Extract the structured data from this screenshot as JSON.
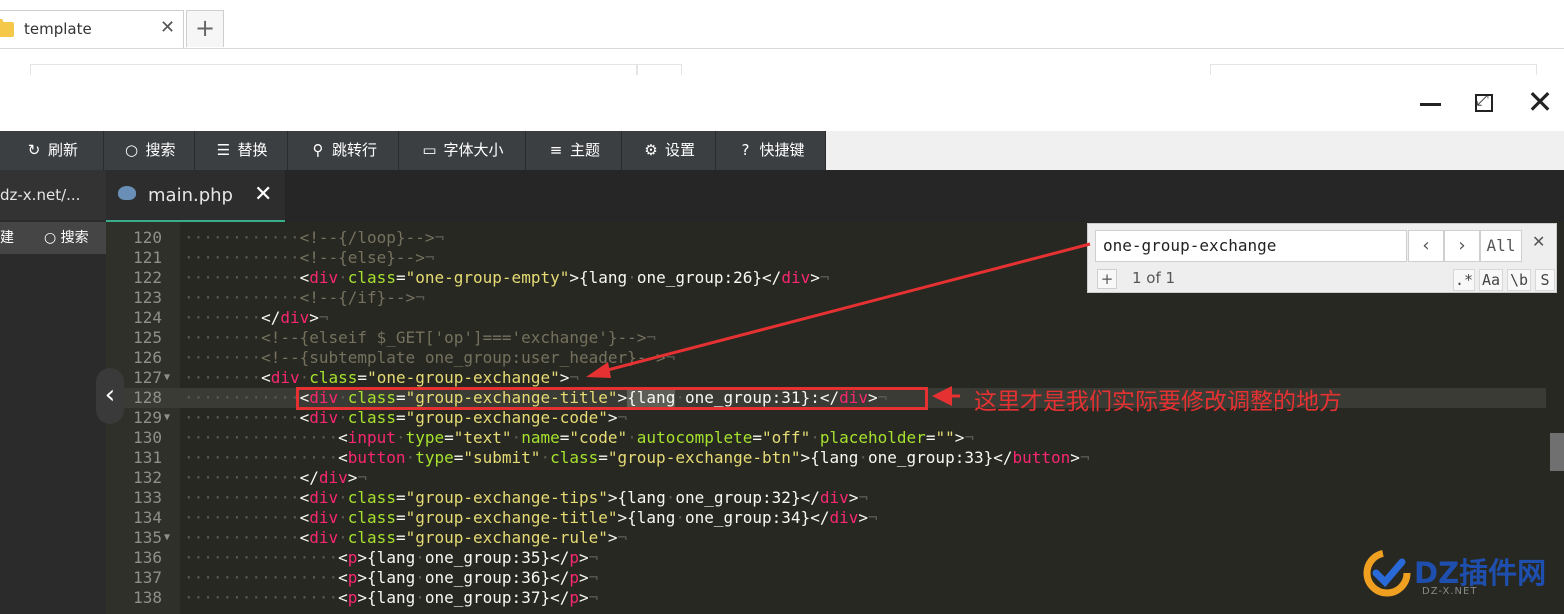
{
  "browser": {
    "tab_title": "template",
    "tab_close": "✕",
    "new_tab": "+"
  },
  "window": {
    "close": "✕"
  },
  "toolbar": {
    "items": [
      {
        "label": "刷新",
        "icon": "↻"
      },
      {
        "label": "搜索",
        "icon": "○"
      },
      {
        "label": "替换",
        "icon": "☰"
      },
      {
        "label": "跳转行",
        "icon": "⚲"
      },
      {
        "label": "字体大小",
        "icon": "▭"
      },
      {
        "label": "主题",
        "icon": "≡"
      },
      {
        "label": "设置",
        "icon": "⚙"
      },
      {
        "label": "快捷键",
        "icon": "?"
      }
    ]
  },
  "left_panel": {
    "tab_label": "dz-x.net/...",
    "action1": "建",
    "action2": "搜索",
    "collapse": "‹"
  },
  "editor": {
    "tab_name": "main.php",
    "tab_close": "✕",
    "lines": [
      {
        "n": "120",
        "indent": 6,
        "code": "<!--{/loop}-->"
      },
      {
        "n": "121",
        "indent": 6,
        "code": "<!--{else}-->"
      },
      {
        "n": "122",
        "indent": 6,
        "code": "<div class=\"one-group-empty\">{lang one_group:26}</div>"
      },
      {
        "n": "123",
        "indent": 6,
        "code": "<!--{/if}-->"
      },
      {
        "n": "124",
        "indent": 4,
        "code": "</div>"
      },
      {
        "n": "125",
        "indent": 4,
        "code": "<!--{elseif $_GET['op']==='exchange'}-->"
      },
      {
        "n": "126",
        "indent": 4,
        "code": "<!--{subtemplate one_group:user_header}-->"
      },
      {
        "n": "127",
        "indent": 4,
        "code": "<div class=\"one-group-exchange\">",
        "fold": true
      },
      {
        "n": "128",
        "indent": 6,
        "code": "<div class=\"group-exchange-title\">{lang one_group:31}:</div>",
        "active": true
      },
      {
        "n": "129",
        "indent": 6,
        "code": "<div class=\"group-exchange-code\">",
        "fold": true
      },
      {
        "n": "130",
        "indent": 8,
        "code": "<input type=\"text\" name=\"code\" autocomplete=\"off\" placeholder=\"\">"
      },
      {
        "n": "131",
        "indent": 8,
        "code": "<button type=\"submit\" class=\"group-exchange-btn\">{lang one_group:33}</button>"
      },
      {
        "n": "132",
        "indent": 6,
        "code": "</div>"
      },
      {
        "n": "133",
        "indent": 6,
        "code": "<div class=\"group-exchange-tips\">{lang one_group:32}</div>"
      },
      {
        "n": "134",
        "indent": 6,
        "code": "<div class=\"group-exchange-title\">{lang one_group:34}</div>"
      },
      {
        "n": "135",
        "indent": 6,
        "code": "<div class=\"group-exchange-rule\">",
        "fold": true
      },
      {
        "n": "136",
        "indent": 8,
        "code": "<p>{lang one_group:35}</p>"
      },
      {
        "n": "137",
        "indent": 8,
        "code": "<p>{lang one_group:36}</p>"
      },
      {
        "n": "138",
        "indent": 8,
        "code": "<p>{lang one_group:37}</p>"
      }
    ]
  },
  "search": {
    "query": "one-group-exchange",
    "prev": "‹",
    "next": "›",
    "all": "All",
    "close": "✕",
    "add": "+",
    "count": "1 of 1",
    "options": [
      ".*",
      "Aa",
      "\\b",
      "S"
    ]
  },
  "annotation": {
    "text": "这里才是我们实际要修改调整的地方",
    "color": "#e53131"
  },
  "watermark": {
    "text": "DZ插件网",
    "sub": "DZ-X.NET"
  },
  "colors": {
    "editor_bg": "#272822",
    "tag": "#f92672",
    "attr": "#a6e22e",
    "string": "#e6db74",
    "comment": "#75715e",
    "accent": "#39ae8a"
  }
}
